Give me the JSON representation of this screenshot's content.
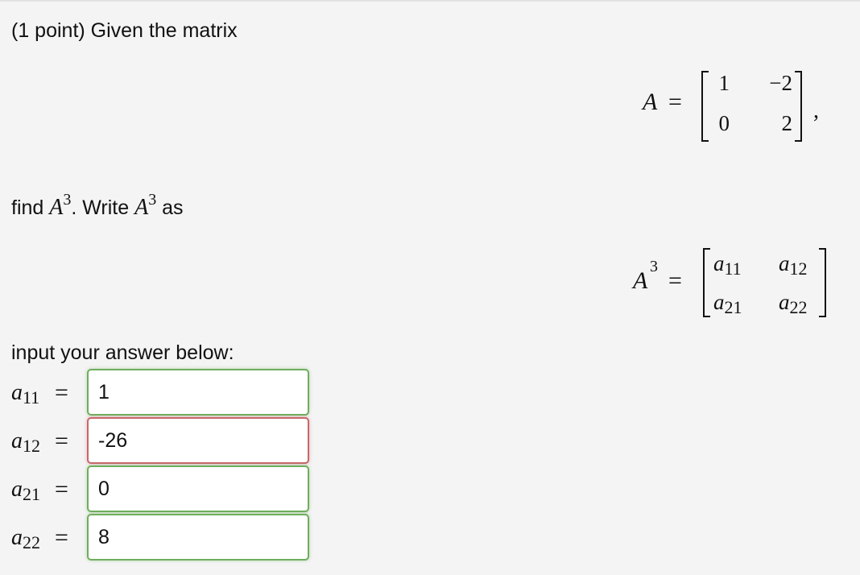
{
  "problem": {
    "intro": "(1 point) Given the matrix",
    "matrix_A": {
      "name": "A",
      "equals": "=",
      "rows": [
        [
          "1",
          "−2"
        ],
        [
          "0",
          "2"
        ]
      ],
      "trailing": ","
    },
    "find_text": {
      "find": "find",
      "A": "A",
      "power": "3",
      "middle": ". Write",
      "A2": "A",
      "power2": "3",
      "end": "as"
    },
    "matrix_A3": {
      "name": "A",
      "power": "3",
      "equals": "=",
      "cells": [
        {
          "var": "a",
          "sub": "11"
        },
        {
          "var": "a",
          "sub": "12"
        },
        {
          "var": "a",
          "sub": "21"
        },
        {
          "var": "a",
          "sub": "22"
        }
      ]
    },
    "input_prompt": "input your answer below:"
  },
  "answers": [
    {
      "var": "a",
      "sub": "11",
      "equals": "=",
      "value": "1",
      "status": "correct"
    },
    {
      "var": "a",
      "sub": "12",
      "equals": "=",
      "value": "-26",
      "status": "incorrect"
    },
    {
      "var": "a",
      "sub": "21",
      "equals": "=",
      "value": "0",
      "status": "correct"
    },
    {
      "var": "a",
      "sub": "22",
      "equals": "=",
      "value": "8",
      "status": "correct"
    }
  ],
  "colors": {
    "correct": "#6fae5e",
    "incorrect": "#c9676a",
    "background": "#f4f4f4"
  }
}
